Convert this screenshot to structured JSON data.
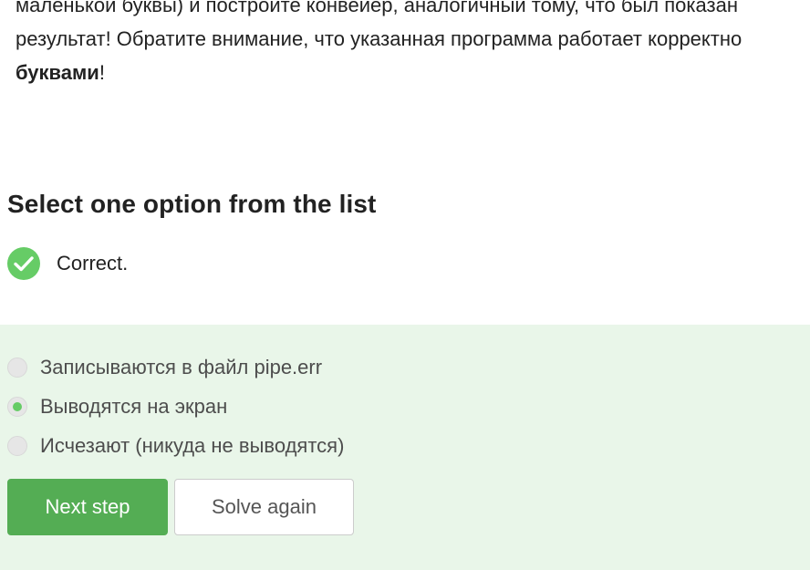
{
  "step_text": {
    "line1": "маленькой буквы) и постройте конвейер, аналогичный тому, что был показан",
    "line2": "результат! Обратите внимание, что указанная программа работает корректно",
    "line3_bold": "буквами",
    "line3_tail": "!"
  },
  "quiz": {
    "title": "Select one option from the list",
    "status": {
      "icon": "check-icon",
      "text": "Correct.",
      "color": "#66cc66"
    },
    "options": [
      {
        "label": "Записываются в файл pipe.err",
        "selected": false
      },
      {
        "label": "Выводятся на экран",
        "selected": true
      },
      {
        "label": "Исчезают (никуда не выводятся)",
        "selected": false
      }
    ],
    "buttons": {
      "next_label": "Next step",
      "solve_again_label": "Solve again"
    }
  },
  "colors": {
    "answer_background": "#e9f6e9",
    "primary_button": "#54ad54"
  }
}
